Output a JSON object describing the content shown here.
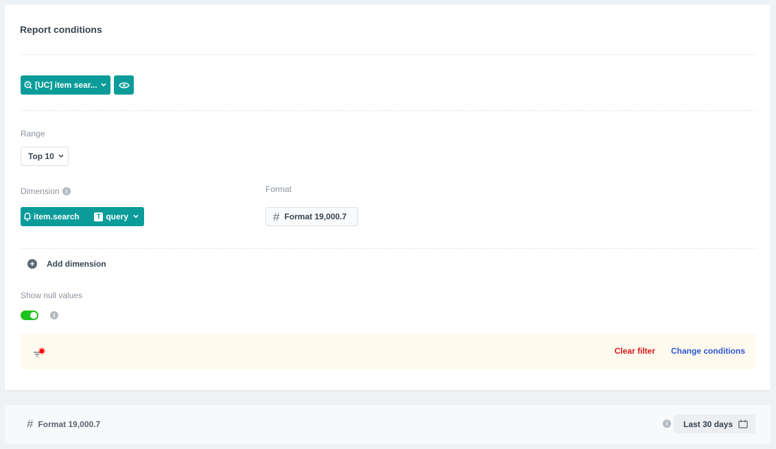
{
  "card": {
    "title": "Report conditions",
    "analysis_select": {
      "label": "[UC] item sear...",
      "icon": "analysis-search-icon"
    },
    "preview": {
      "icon": "eye-icon"
    },
    "range": {
      "label": "Range",
      "selected": "Top 10"
    },
    "dimension": {
      "label": "Dimension",
      "event": "item.search",
      "parameter_type": "T",
      "parameter": "query"
    },
    "format": {
      "label": "Format",
      "value": "Format 19,000.7",
      "icon": "hash-icon"
    },
    "add_dimension": {
      "label": "Add dimension",
      "plus": "+"
    },
    "null_values": {
      "label": "Show null values",
      "enabled": true
    },
    "info_glyph": "i",
    "filter_bar": {
      "clear_label": "Clear filter",
      "change_label": "Change conditions",
      "colors": {
        "clear": "#d8171e",
        "change": "#2d56d6",
        "badge": "#ff0000"
      }
    }
  },
  "bottom_bar": {
    "format_label": "Format 19,000.7",
    "date_range": "Last 30 days"
  },
  "colors": {
    "accent": "#0b9c9a",
    "toggle_on": "#1ec21e"
  }
}
